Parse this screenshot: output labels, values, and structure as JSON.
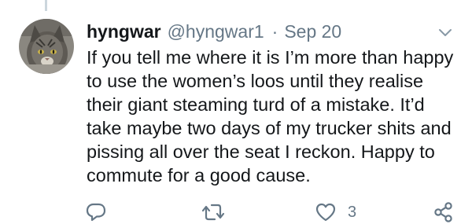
{
  "tweet": {
    "display_name": "hyngwar",
    "handle": "@hyngwar1",
    "separator": "·",
    "date": "Sep 20",
    "text": "If you tell me where it is I’m more than happy\nto use the women’s loos until they realise\ntheir giant steaming turd of a mistake. It’d\ntake maybe two days of my trucker shits and\npissing all over the seat I reckon. Happy to\ncommute for a good cause.",
    "avatar_icon": "cat-photo-avatar"
  },
  "actions": {
    "reply_icon": "reply-icon",
    "retweet_icon": "retweet-icon",
    "like_icon": "heart-icon",
    "like_count": "3",
    "share_icon": "share-icon"
  },
  "colors": {
    "text": "#14171a",
    "secondary": "#657786",
    "icon": "#657786",
    "thread_line": "#ccd6dd"
  }
}
